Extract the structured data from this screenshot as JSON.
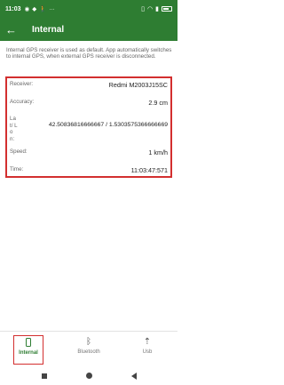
{
  "status_bar": {
    "time": "11:03",
    "left_icons": [
      "shield-icon",
      "water-drop-icon",
      "walk-icon",
      "more-icon"
    ],
    "right_icons": [
      "vibrate-icon",
      "wifi-icon",
      "signal-icon",
      "battery-icon"
    ]
  },
  "app_bar": {
    "title": "Internal"
  },
  "info_text": "Internal GPS receiver is used as default. App automatically switches to internal GPS, when external GPS receiver is disconnected.",
  "details": {
    "receiver": {
      "label": "Receiver:",
      "value": "Redmi M2003J15SC"
    },
    "accuracy": {
      "label": "Accuracy:",
      "value": "2.9 cm"
    },
    "latlon": {
      "label": "La t/ Lo n:",
      "value": "42.50836816666667 / 1.5303575366666669"
    },
    "speed": {
      "label": "Speed:",
      "value": "1 km/h"
    },
    "time": {
      "label": "Time:",
      "value": "11:03:47:571"
    }
  },
  "bottom_nav": {
    "items": [
      {
        "label": "Internal",
        "icon": "phone-icon",
        "active": true
      },
      {
        "label": "Bluetooth",
        "icon": "bluetooth-icon",
        "active": false
      },
      {
        "label": "Usb",
        "icon": "usb-icon",
        "active": false
      }
    ]
  },
  "colors": {
    "primary": "#2e7d32",
    "highlight": "#d32f2f"
  }
}
